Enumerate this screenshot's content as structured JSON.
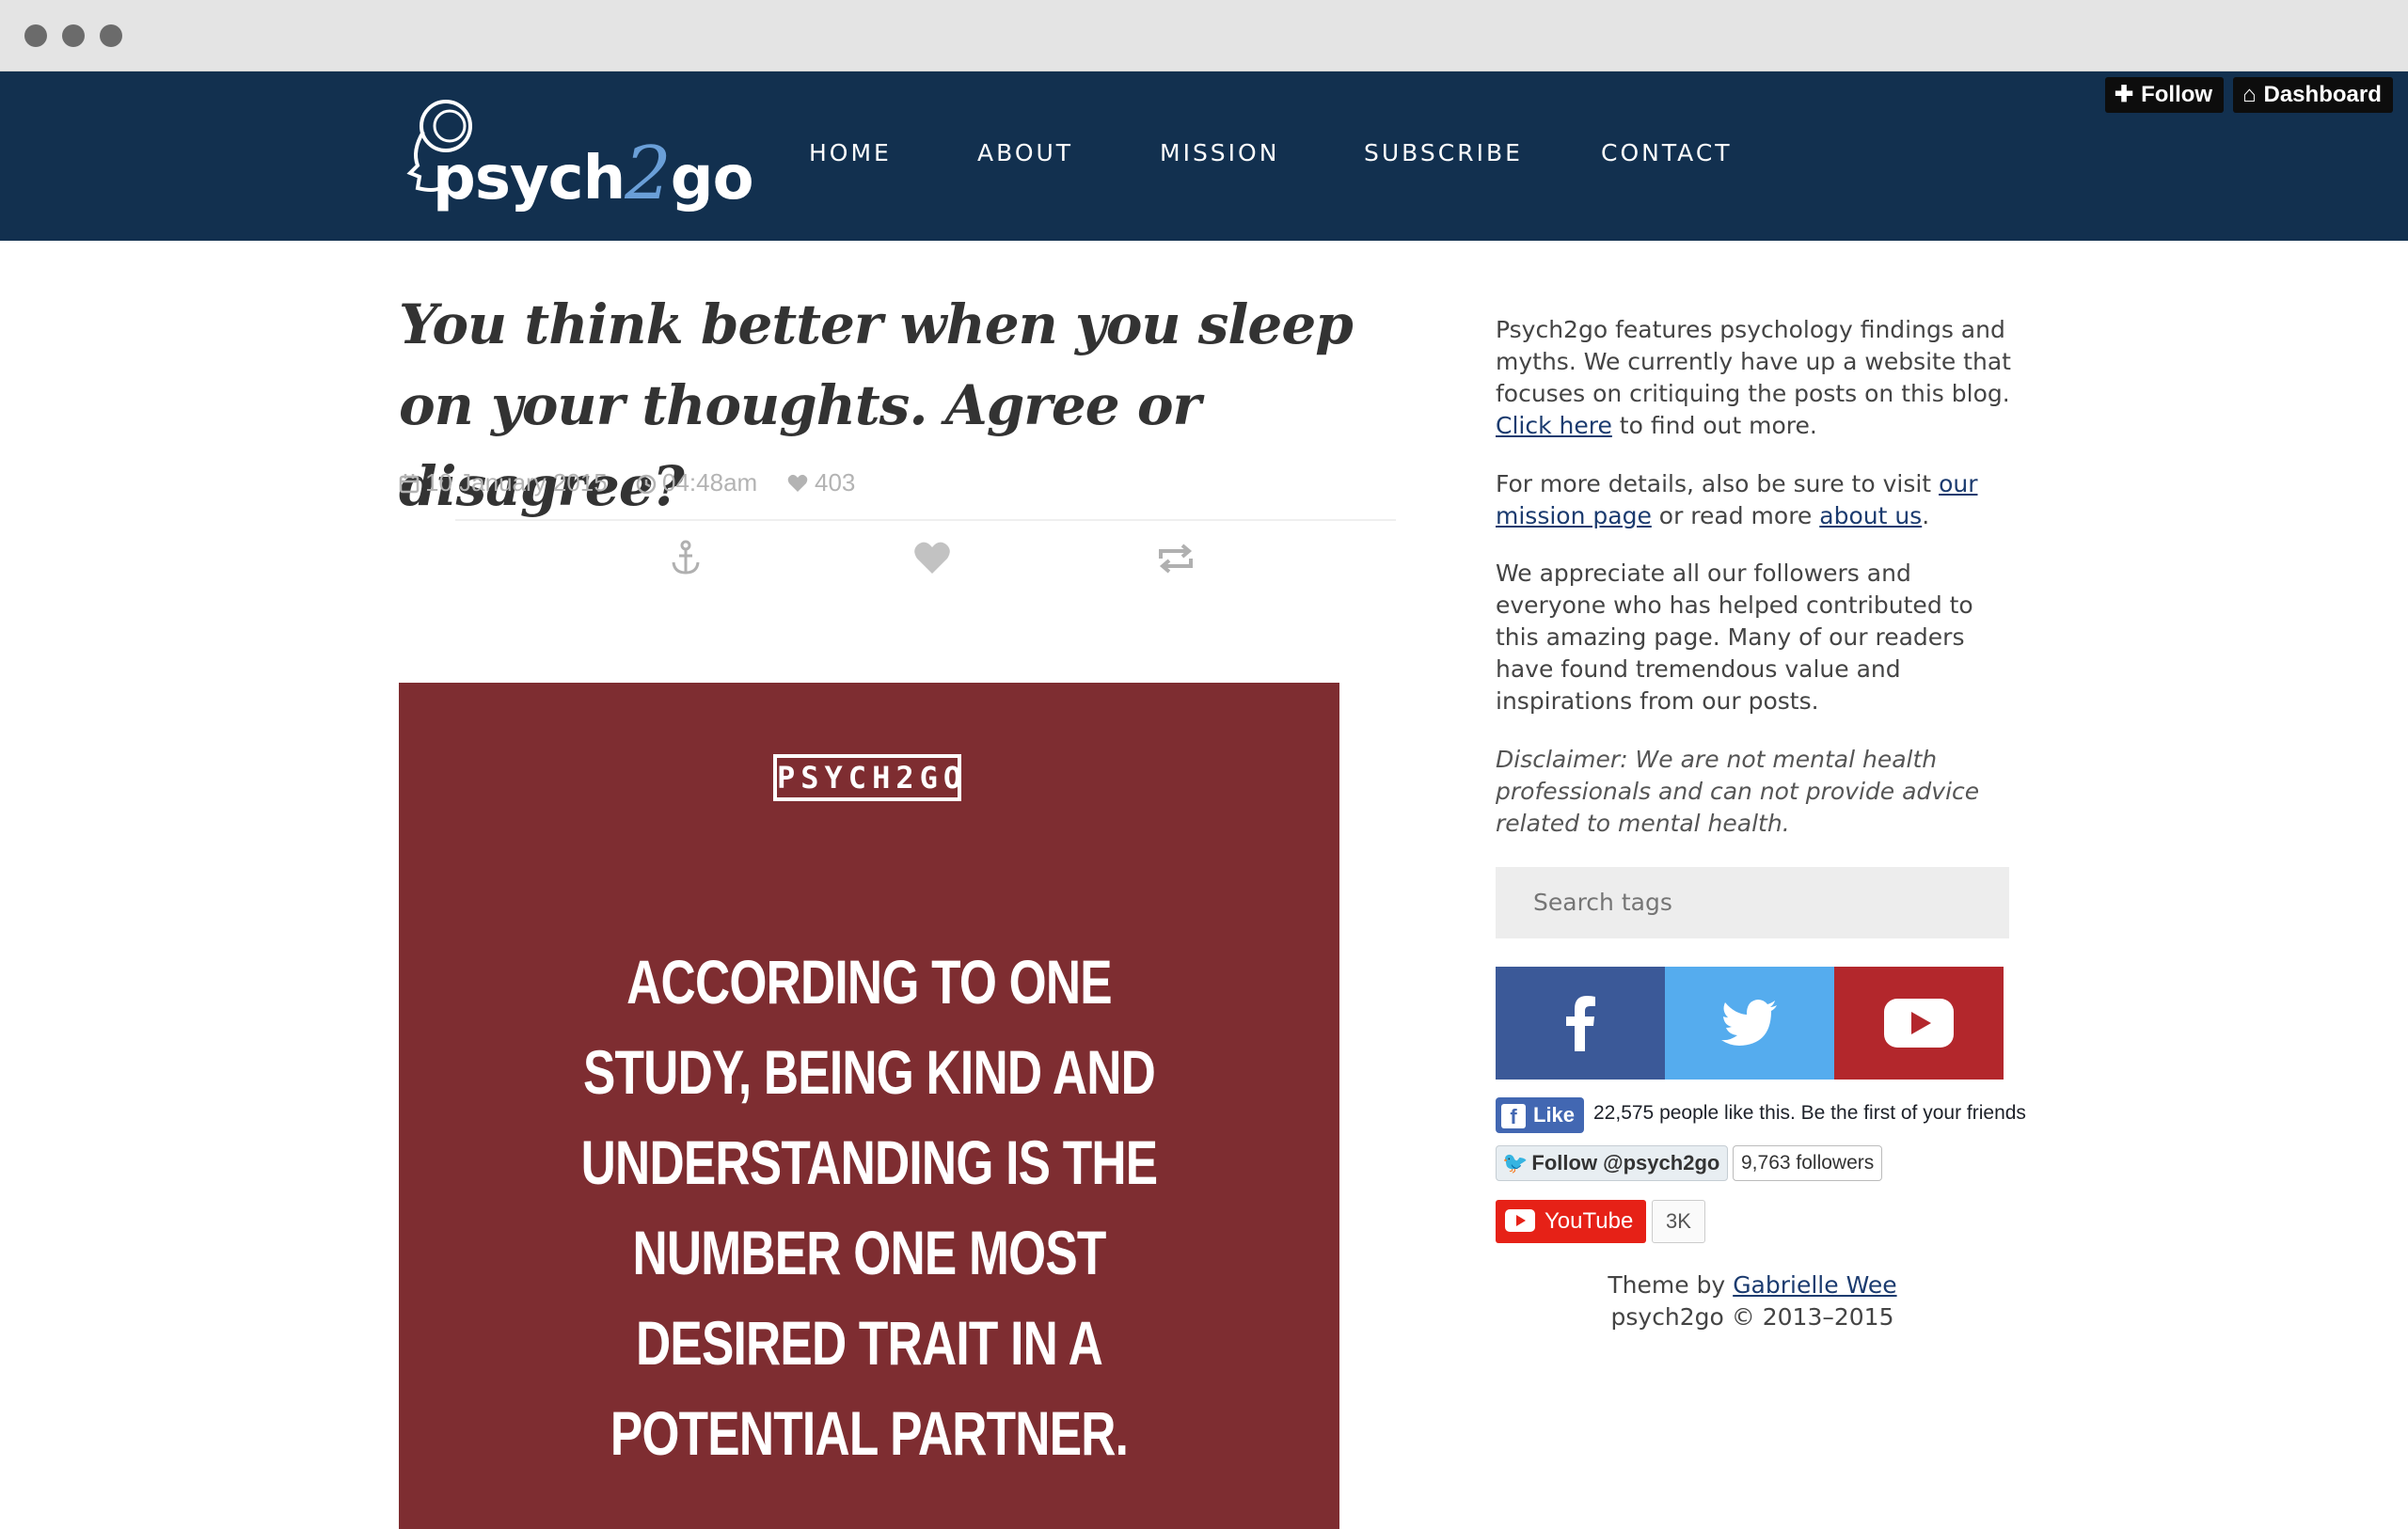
{
  "nav": {
    "items": [
      "HOME",
      "ABOUT",
      "MISSION",
      "SUBSCRIBE",
      "CONTACT"
    ]
  },
  "toolbar": {
    "follow_label": "Follow",
    "dashboard_label": "Dashboard"
  },
  "logo": {
    "text_left": "psych",
    "text_mid": "2",
    "text_right": "go"
  },
  "post": {
    "title": "You think better when you sleep on your thoughts. Agree or disagree?",
    "date": "10 January 2015",
    "time": "04:48am",
    "notes": "403",
    "image_badge": "PSYCH2GO",
    "image_quote": "ACCORDING TO ONE STUDY, BEING KIND AND UNDERSTANDING IS THE NUMBER ONE MOST DESIRED TRAIT IN A POTENTIAL PARTNER."
  },
  "sidebar": {
    "intro_text": "Psych2go features psychology findings and myths. We currently have up a website that focuses on critiquing the posts on this blog.",
    "intro_link": "Click here",
    "intro_tail": " to find out more.",
    "details_text": "For more details, also be sure to visit ",
    "details_link1": "our mission page",
    "details_mid": " or read more ",
    "details_link2": "about us",
    "details_tail": ".",
    "appreciate_text": "We appreciate all our followers and everyone who has helped contributed to this amazing page. Many of our readers have found tremendous value and inspirations from our posts.",
    "disclaimer": "Disclaimer: We are not mental health professionals and can not provide advice related to mental health.",
    "search_placeholder": "Search tags"
  },
  "social": {
    "facebook_color": "#3b5998",
    "twitter_color": "#55acee",
    "youtube_color": "#b3272c",
    "fb_like_label": "Like",
    "fb_like_text": "22,575 people like this. Be the first of your friends.",
    "tw_follow_label": "Follow @psych2go",
    "tw_followers": "9,763 followers",
    "yt_label": "YouTube",
    "yt_count": "3K"
  },
  "footer": {
    "theme_by": "Theme by ",
    "theme_author": "Gabrielle Wee",
    "copyright": "psych2go © 2013–2015"
  }
}
